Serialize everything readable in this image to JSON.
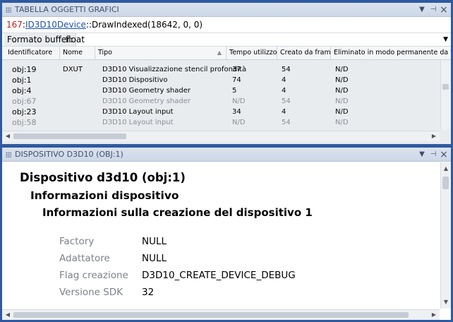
{
  "top_panel": {
    "title": "TABELLA OGGETTI GRAFICI",
    "call": {
      "number": "167",
      "sep": ":",
      "interface": "ID3D10Device",
      "method": "::DrawIndexed(18642, 0, 0)"
    },
    "buffer_format": {
      "label": "Formato buffer:",
      "value": "float"
    },
    "columns": [
      "Identificatore",
      "Nome",
      "Tipo",
      "Tempo utilizzo",
      "Creato da frame",
      "Eliminato in modo permanente da fr..."
    ],
    "rows": [
      {
        "id": "obj:19",
        "name": "DXUT",
        "type": "D3D10 Visualizzazione stencil profondità",
        "time": "37",
        "frame": "54",
        "deleted": "N/D",
        "dim": false
      },
      {
        "id": "obj:1",
        "name": "",
        "type": "D3D10 Dispositivo",
        "time": "74",
        "frame": "4",
        "deleted": "N/D",
        "dim": false
      },
      {
        "id": "obj:4",
        "name": "",
        "type": "D3D10 Geometry shader",
        "time": "5",
        "frame": "4",
        "deleted": "N/D",
        "dim": false
      },
      {
        "id": "obj:67",
        "name": "",
        "type": "D3D10 Geometry shader",
        "time": "N/D",
        "frame": "54",
        "deleted": "N/D",
        "dim": true
      },
      {
        "id": "obj:23",
        "name": "",
        "type": "D3D10 Layout input",
        "time": "34",
        "frame": "4",
        "deleted": "N/D",
        "dim": false
      },
      {
        "id": "obj:58",
        "name": "",
        "type": "D3D10 Layout input",
        "time": "N/D",
        "frame": "54",
        "deleted": "N/D",
        "dim": true
      }
    ]
  },
  "bottom_panel": {
    "title": "DISPOSITIVO D3D10 (OBJ:1)",
    "heading1": "Dispositivo d3d10 (obj:1)",
    "heading2": "Informazioni dispositivo",
    "heading3": "Informazioni sulla creazione del dispositivo 1",
    "properties": [
      {
        "label": "Factory",
        "value": "NULL"
      },
      {
        "label": "Adattatore",
        "value": "NULL"
      },
      {
        "label": "Flag creazione",
        "value": "D3D10_CREATE_DEVICE_DEBUG"
      },
      {
        "label": "Versione SDK",
        "value": "32"
      }
    ]
  },
  "icons": {
    "dropdown": "▼",
    "pin": "⊣",
    "close": "×",
    "sort_up": "▲",
    "scroll_left": "◀",
    "scroll_right": "▶",
    "scroll_up": "▲",
    "scroll_down": "▼",
    "grip": "|||"
  }
}
